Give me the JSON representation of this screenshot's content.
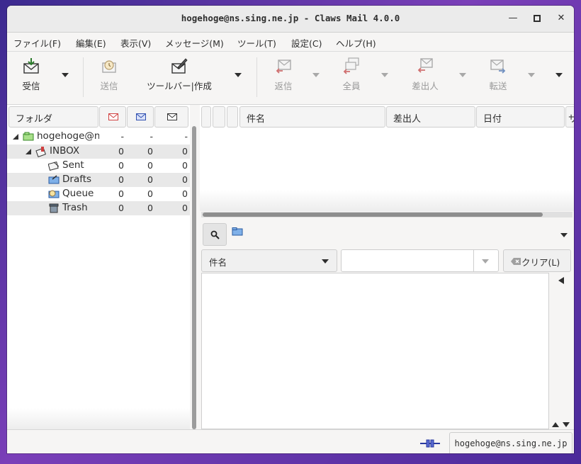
{
  "window": {
    "title": "hogehoge@ns.sing.ne.jp - Claws Mail 4.0.0",
    "minimize_glyph": "—",
    "maximize_glyph": "▫",
    "close_glyph": "✕"
  },
  "menubar": [
    "ファイル(F)",
    "編集(E)",
    "表示(V)",
    "メッセージ(M)",
    "ツール(T)",
    "設定(C)",
    "ヘルプ(H)"
  ],
  "toolbar": {
    "receive": "受信",
    "send": "送信",
    "compose": "ツールバー|作成",
    "reply": "返信",
    "reply_all": "全員",
    "reply_sender": "差出人",
    "forward": "転送"
  },
  "folder_pane": {
    "header": "フォルダ",
    "rows": [
      {
        "name": "hogehoge@ns",
        "unread": "-",
        "new": "-",
        "total": "-",
        "icon": "account-icon"
      },
      {
        "name": "INBOX",
        "unread": "0",
        "new": "0",
        "total": "0",
        "icon": "inbox-icon"
      },
      {
        "name": "Sent",
        "unread": "0",
        "new": "0",
        "total": "0",
        "icon": "sent-icon"
      },
      {
        "name": "Drafts",
        "unread": "0",
        "new": "0",
        "total": "0",
        "icon": "drafts-icon"
      },
      {
        "name": "Queue",
        "unread": "0",
        "new": "0",
        "total": "0",
        "icon": "queue-icon"
      },
      {
        "name": "Trash",
        "unread": "0",
        "new": "0",
        "total": "0",
        "icon": "trash-icon"
      }
    ]
  },
  "message_list": {
    "columns": [
      "件名",
      "差出人",
      "日付",
      "サ"
    ]
  },
  "search": {
    "field_option": "件名",
    "input_value": "",
    "clear_label": "クリア(L)"
  },
  "status": {
    "account": "hogehoge@ns.sing.ne.jp"
  }
}
